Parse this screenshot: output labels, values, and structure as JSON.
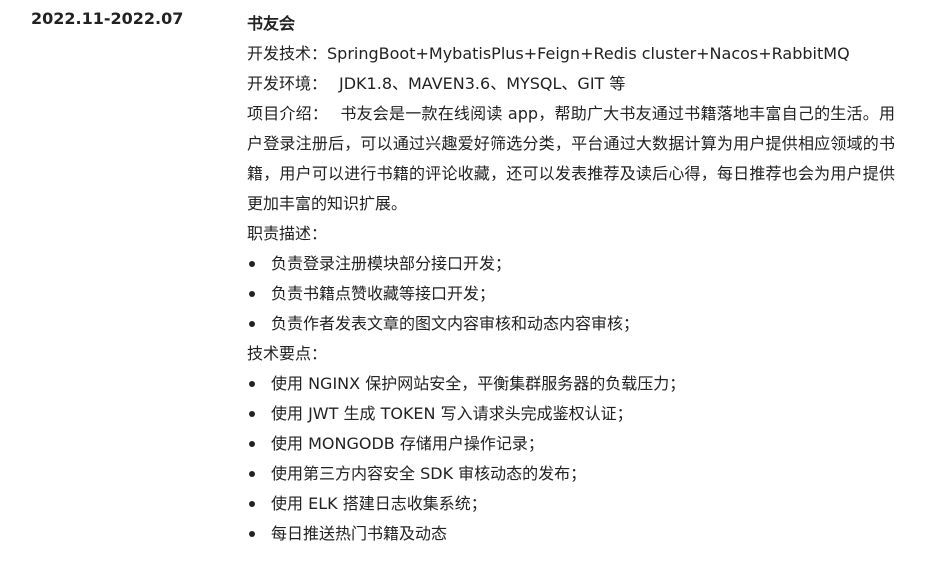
{
  "period": "2022.11-2022.07",
  "project": {
    "title": "书友会",
    "tech_label": "开发技术：",
    "tech_value": "SpringBoot+MybatisPlus+Feign+Redis cluster+Nacos+RabbitMQ",
    "env_label": "开发环境：",
    "env_value": "JDK1.8、MAVEN3.6、MYSQL、GIT 等",
    "intro_label": "项目介绍：",
    "intro_value": "书友会是一款在线阅读 app，帮助广大书友通过书籍落地丰富自己的生活。用户登录注册后，可以通过兴趣爱好筛选分类，平台通过大数据计算为用户提供相应领域的书籍，用户可以进行书籍的评论收藏，还可以发表推荐及读后心得，每日推荐也会为用户提供更加丰富的知识扩展。",
    "duties_label": "职责描述：",
    "duties": [
      "负责登录注册模块部分接口开发；",
      "负责书籍点赞收藏等接口开发；",
      "负责作者发表文章的图文内容审核和动态内容审核；"
    ],
    "tech_points_label": "技术要点：",
    "tech_points": [
      "使用 NGINX 保护网站安全，平衡集群服务器的负载压力；",
      "使用 JWT 生成 TOKEN 写入请求头完成鉴权认证；",
      "使用 MONGODB 存储用户操作记录；",
      "使用第三方内容安全 SDK 审核动态的发布；",
      "使用 ELK 搭建日志收集系统；",
      "每日推送热门书籍及动态"
    ]
  }
}
